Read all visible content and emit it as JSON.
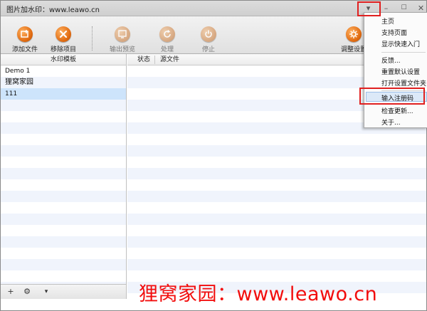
{
  "window": {
    "title": "图片加水印：www.leawo.cn",
    "controls": {
      "dropdown": "▾",
      "minimize": "–",
      "maximize": "☐",
      "close": "✕"
    }
  },
  "toolbar": {
    "add_file": "添加文件",
    "remove_item": "移除项目",
    "output_preview": "输出预览",
    "process": "处理",
    "stop": "停止",
    "adjust_settings": "调整设置"
  },
  "left_panel": {
    "header": "水印模板",
    "templates": [
      "Demo 1",
      "狸窝家园",
      "111"
    ]
  },
  "right_panel": {
    "col_status": "状态",
    "col_source": "源文件"
  },
  "footer": {
    "add": "+",
    "settings": "⚙",
    "more": "▾"
  },
  "menu": {
    "items": [
      "主页",
      "支持页面",
      "显示快速入门",
      "反馈...",
      "重置默认设置",
      "打开设置文件夹",
      "输入注册码",
      "检查更新...",
      "关于..."
    ],
    "highlighted": "输入注册码"
  },
  "watermark": "狸窝家园：www.leawo.cn",
  "colors": {
    "icon_orange": "#e06a10",
    "highlight_red": "#e02020",
    "watermark_red": "#f20d0d",
    "selection_blue": "#cde4fb"
  },
  "icons": [
    "add-file-icon",
    "remove-item-icon",
    "output-preview-icon",
    "process-icon",
    "stop-icon",
    "settings-icon",
    "gear-icon",
    "plus-icon"
  ]
}
